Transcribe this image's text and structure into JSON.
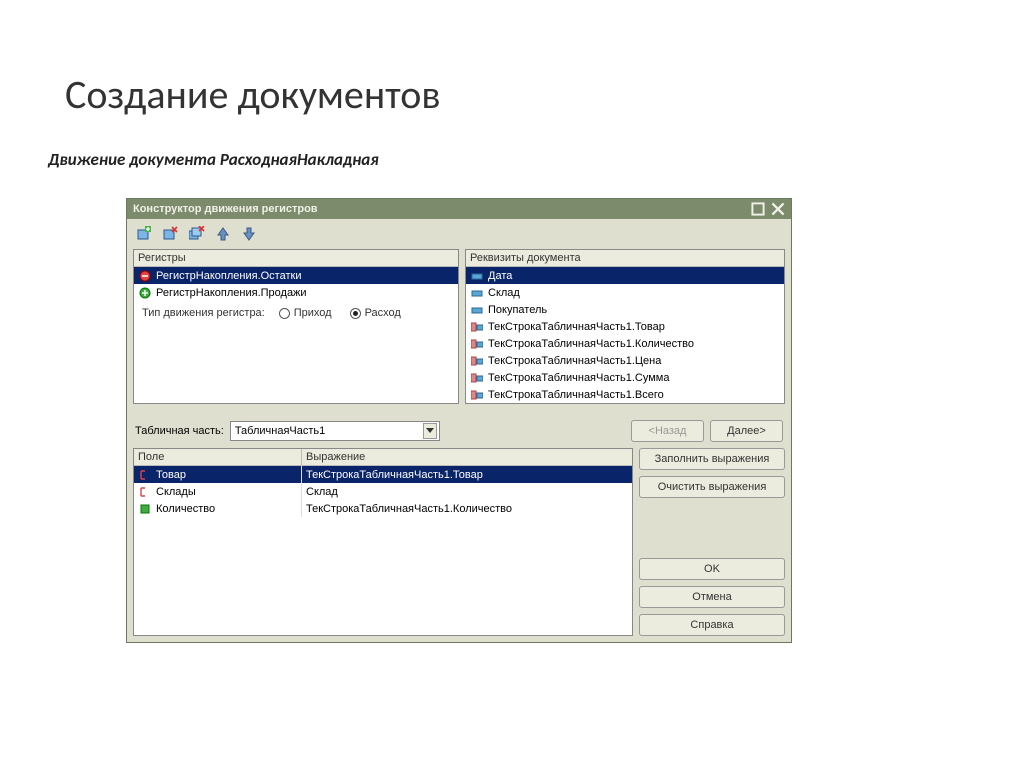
{
  "slide": {
    "title": "Создание документов",
    "subtitle": "Движение документа РасходнаяНакладная"
  },
  "window": {
    "title": "Конструктор движения регистров"
  },
  "panes": {
    "registers_header": "Регистры",
    "attributes_header": "Реквизиты документа"
  },
  "registers": [
    {
      "label": "РегистрНакопления.Остатки",
      "selected": true,
      "icon": "minus"
    },
    {
      "label": "РегистрНакопления.Продажи",
      "selected": false,
      "icon": "plus"
    }
  ],
  "attributes": [
    {
      "label": "Дата",
      "selected": true,
      "icon": "attr"
    },
    {
      "label": "Склад",
      "selected": false,
      "icon": "attr"
    },
    {
      "label": "Покупатель",
      "selected": false,
      "icon": "attr"
    },
    {
      "label": "ТекСтрокаТабличнаяЧасть1.Товар",
      "selected": false,
      "icon": "tab"
    },
    {
      "label": "ТекСтрокаТабличнаяЧасть1.Количество",
      "selected": false,
      "icon": "tab"
    },
    {
      "label": "ТекСтрокаТабличнаяЧасть1.Цена",
      "selected": false,
      "icon": "tab"
    },
    {
      "label": "ТекСтрокаТабличнаяЧасть1.Сумма",
      "selected": false,
      "icon": "tab"
    },
    {
      "label": "ТекСтрокаТабличнаяЧасть1.Всего",
      "selected": false,
      "icon": "tab"
    }
  ],
  "movement": {
    "label": "Тип движения регистра:",
    "option_in": "Приход",
    "option_out": "Расход",
    "selected": "Расход"
  },
  "tab_section": {
    "label": "Табличная часть:",
    "value": "ТабличнаяЧасть1"
  },
  "table": {
    "header_field": "Поле",
    "header_expr": "Выражение",
    "rows": [
      {
        "field": "Товар",
        "expr": "ТекСтрокаТабличнаяЧасть1.Товар",
        "selected": true,
        "icon": "arrow"
      },
      {
        "field": "Склады",
        "expr": "Склад",
        "selected": false,
        "icon": "arrow"
      },
      {
        "field": "Количество",
        "expr": "ТекСтрокаТабличнаяЧасть1.Количество",
        "selected": false,
        "icon": "box"
      }
    ]
  },
  "buttons": {
    "back": "<Назад",
    "next": "Далее>",
    "fill": "Заполнить выражения",
    "clear": "Очистить выражения",
    "ok": "OK",
    "cancel": "Отмена",
    "help": "Справка"
  }
}
